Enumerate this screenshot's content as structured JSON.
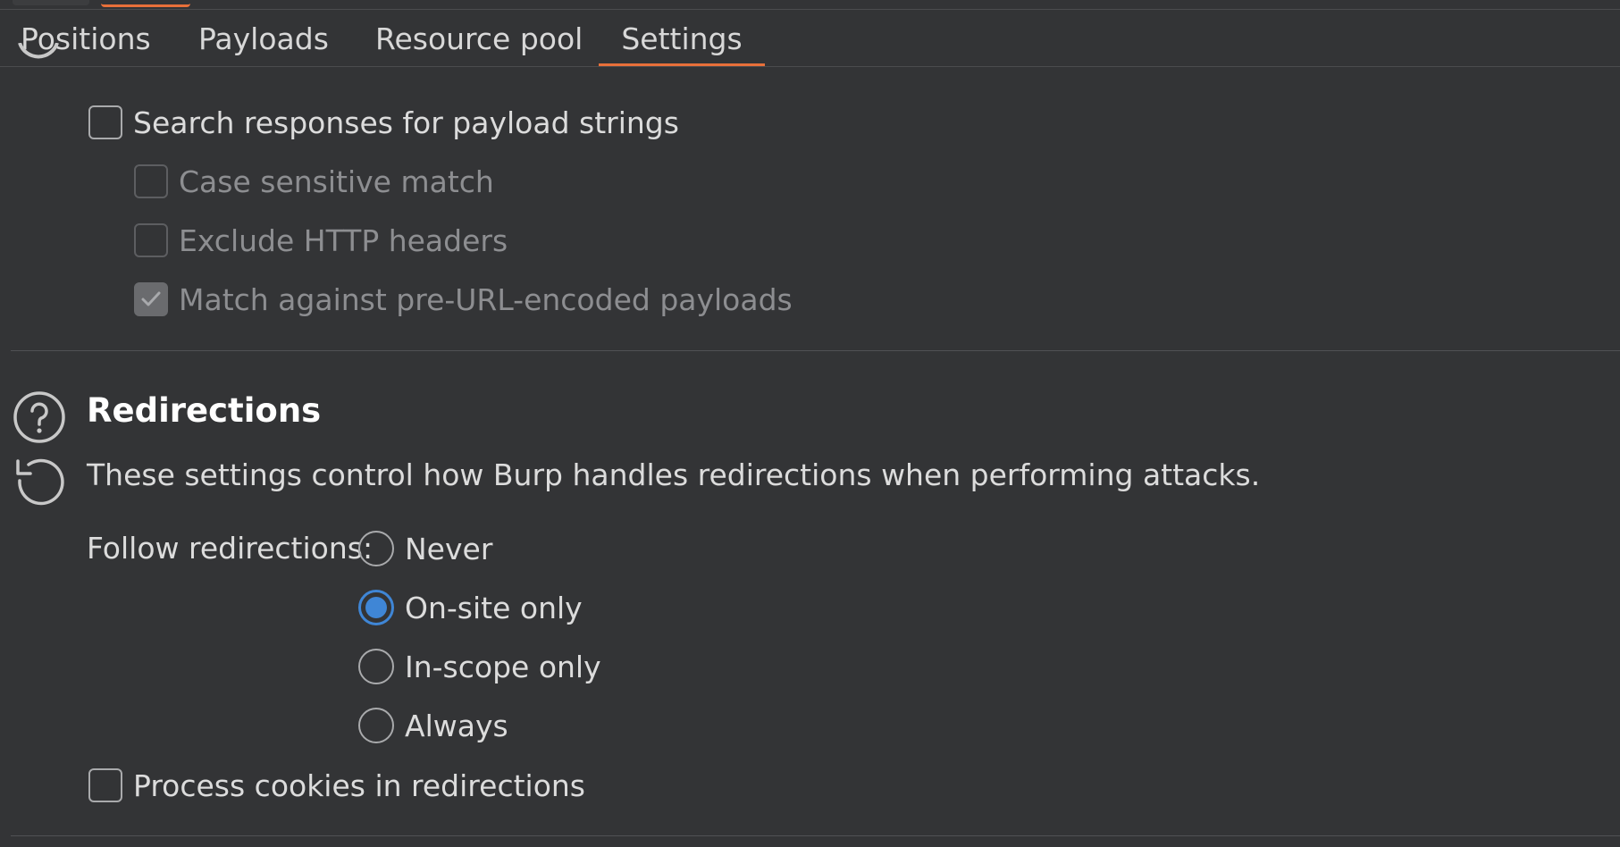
{
  "tabs": {
    "positions": "Positions",
    "payloads": "Payloads",
    "resource_pool": "Resource pool",
    "settings": "Settings",
    "active": "Settings"
  },
  "grep_payloads": {
    "search_responses": {
      "label": "Search responses for payload strings",
      "checked": false,
      "enabled": true
    },
    "case_sensitive": {
      "label": "Case sensitive match",
      "checked": false,
      "enabled": false
    },
    "exclude_headers": {
      "label": "Exclude HTTP headers",
      "checked": false,
      "enabled": false
    },
    "match_pre_url": {
      "label": "Match against pre-URL-encoded payloads",
      "checked": true,
      "enabled": false
    }
  },
  "redirections": {
    "title": "Redirections",
    "description": "These settings control how Burp handles redirections when performing attacks.",
    "follow_label": "Follow redirections:",
    "options": {
      "never": "Never",
      "on_site": "On-site only",
      "in_scope": "In-scope only",
      "always": "Always"
    },
    "selected": "On-site only",
    "process_cookies": {
      "label": "Process cookies in redirections",
      "checked": false
    }
  },
  "icons": {
    "help": "help-circle-icon",
    "reset": "reset-defaults-icon",
    "check": "checkmark-icon"
  },
  "colors": {
    "background": "#333436",
    "accent_tab": "#e8703a",
    "radio_selected": "#3f86d6"
  }
}
